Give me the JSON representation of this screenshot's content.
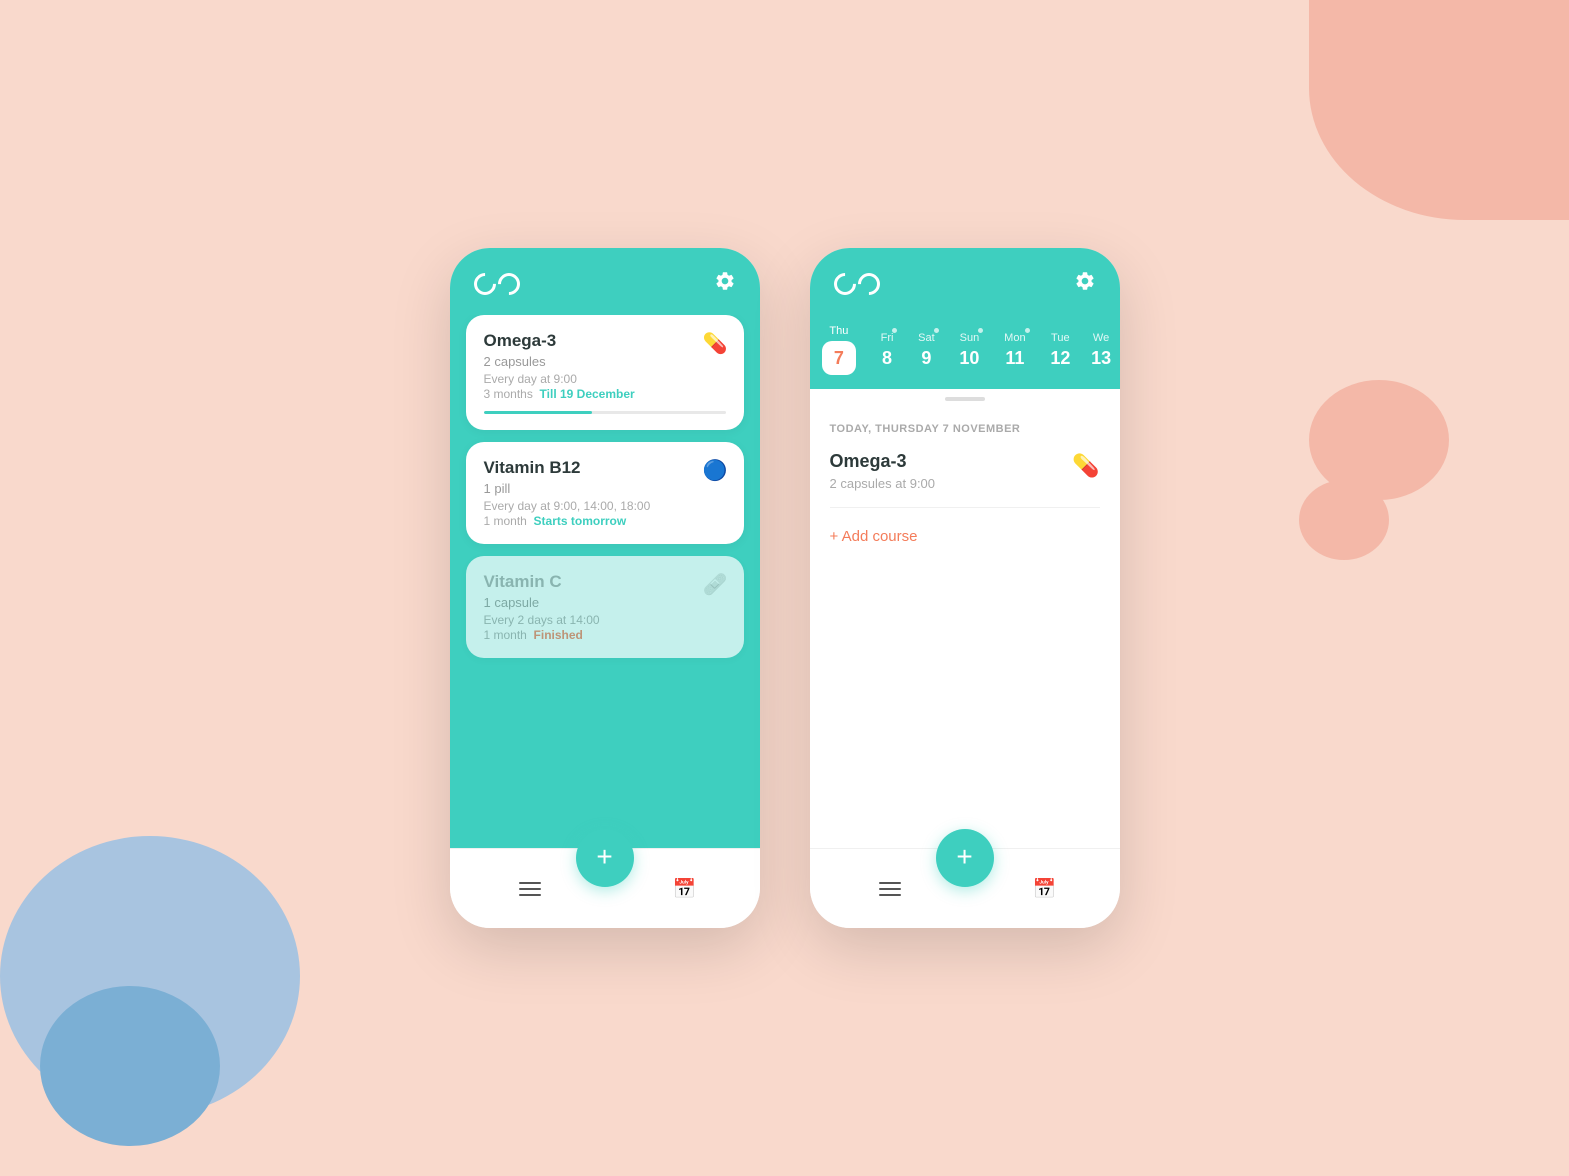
{
  "background": {
    "color": "#f9d9cc"
  },
  "phone1": {
    "header": {
      "logo": "CD",
      "settings_label": "settings"
    },
    "medications": [
      {
        "id": "omega3",
        "name": "Omega-3",
        "dosage": "2 capsules",
        "schedule": "Every day at 9:00",
        "duration_label": "3 months",
        "duration_detail": "Till 19 December",
        "progress": 45,
        "icon_type": "capsule-red",
        "faded": false
      },
      {
        "id": "vitaminb12",
        "name": "Vitamin B12",
        "dosage": "1 pill",
        "schedule": "Every day at 9:00, 14:00, 18:00",
        "duration_label": "1 month",
        "duration_detail": "Starts tomorrow",
        "progress": null,
        "icon_type": "pill-blue",
        "faded": false
      },
      {
        "id": "vitaminc",
        "name": "Vitamin C",
        "dosage": "1 capsule",
        "schedule": "Every 2 days at 14:00",
        "duration_label": "1 month",
        "duration_detail": "Finished",
        "progress": null,
        "icon_type": "capsule-pink",
        "faded": true
      }
    ],
    "nav": {
      "add_label": "+",
      "menu_label": "menu",
      "calendar_label": "calendar"
    }
  },
  "phone2": {
    "header": {
      "logo": "CD",
      "settings_label": "settings"
    },
    "calendar": {
      "days": [
        {
          "name": "Thu",
          "num": "7",
          "active": true,
          "dot": false
        },
        {
          "name": "Fri",
          "num": "8",
          "active": false,
          "dot": true
        },
        {
          "name": "Sat",
          "num": "9",
          "active": false,
          "dot": true
        },
        {
          "name": "Sun",
          "num": "10",
          "active": false,
          "dot": true
        },
        {
          "name": "Mon",
          "num": "11",
          "active": false,
          "dot": true
        },
        {
          "name": "Tue",
          "num": "12",
          "active": false,
          "dot": false
        },
        {
          "name": "We",
          "num": "13",
          "active": false,
          "dot": false
        }
      ]
    },
    "today_label": "TODAY, THURSDAY 7 NOVEMBER",
    "today_medication": {
      "name": "Omega-3",
      "detail": "2 capsules at 9:00",
      "icon_type": "capsule-red"
    },
    "add_course_label": "+ Add course",
    "nav": {
      "add_label": "+",
      "menu_label": "menu",
      "calendar_label": "calendar"
    }
  }
}
